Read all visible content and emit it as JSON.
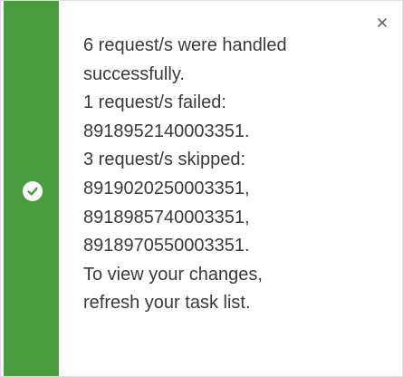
{
  "notification": {
    "status": "success",
    "status_icon": "check-circle-icon",
    "close_icon": "close-icon",
    "accent_color": "#4a9d3f",
    "lines": [
      "6 request/s were handled",
      "successfully.",
      "1 request/s failed:",
      "8918952140003351.",
      "3 request/s skipped:",
      "8919020250003351,",
      "8918985740003351,",
      "8918970550003351.",
      "To view your changes,",
      "refresh your task list."
    ]
  }
}
